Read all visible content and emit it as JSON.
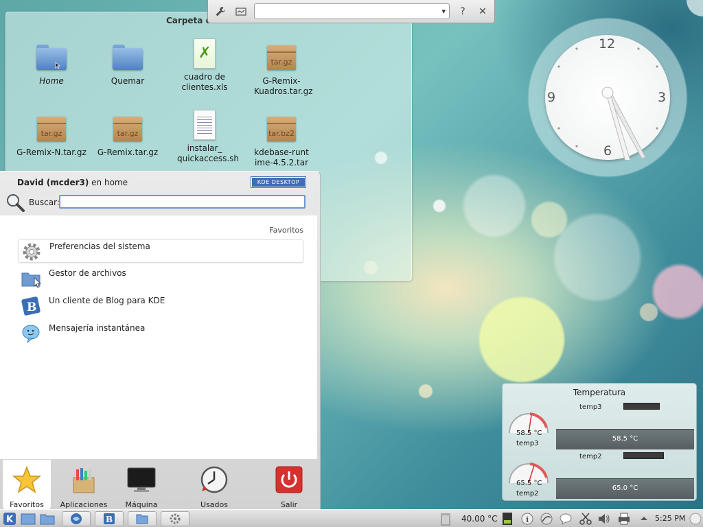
{
  "folder_view": {
    "title": "Carpeta de",
    "files": [
      {
        "name": "Home",
        "kind": "folder",
        "label_style": "italic"
      },
      {
        "name": "Quemar",
        "kind": "folder"
      },
      {
        "name": "cuadro de clientes.xls",
        "kind": "spreadsheet"
      },
      {
        "name": "G-Remix-Kuadros.tar.gz",
        "kind": "archive",
        "badge": "tar.gz"
      },
      {
        "name": "G-Remix-N.tar.gz",
        "kind": "archive",
        "badge": "tar.gz"
      },
      {
        "name": "G-Remix.tar.gz",
        "kind": "archive",
        "badge": "tar.gz"
      },
      {
        "name": "instalar_ quickaccess.sh",
        "kind": "script"
      },
      {
        "name": "kdebase-runtime-4.5.2.tar",
        "kind": "archive",
        "badge": "tar.bz2"
      }
    ]
  },
  "toolbar": {
    "icons": [
      "wrench-icon",
      "configure-icon",
      "help-icon",
      "close-icon"
    ],
    "help_glyph": "?",
    "close_glyph": "✕",
    "combo_value": ""
  },
  "clock": {
    "numerals": [
      "12",
      "3",
      "6",
      "9"
    ],
    "time": "5:25 PM"
  },
  "launcher": {
    "user_name": "David (mcder3)",
    "user_suffix": " en home",
    "badge": "KDE DESKTOP",
    "search_label": "Buscar:",
    "search_value": "",
    "section_title": "Favoritos",
    "favorites": [
      {
        "label": "Preferencias del sistema",
        "icon": "gear-icon"
      },
      {
        "label": "Gestor de archivos",
        "icon": "folder-icon"
      },
      {
        "label": "Un cliente de Blog para KDE",
        "icon": "blog-icon"
      },
      {
        "label": "Mensajería instantánea",
        "icon": "chat-icon"
      }
    ],
    "tabs": [
      {
        "label": "Favoritos",
        "icon": "star-icon",
        "active": true
      },
      {
        "label": "Aplicaciones",
        "icon": "applications-icon"
      },
      {
        "label": "Máquina",
        "icon": "computer-icon"
      },
      {
        "label": "Usados recientemente",
        "icon": "recent-clock-icon"
      },
      {
        "label": "Salir",
        "icon": "power-icon"
      }
    ]
  },
  "temperature": {
    "title": "Temperatura",
    "sensors": [
      {
        "name": "temp3",
        "value": "58.5 °C",
        "graph_value": "58.5 °C",
        "level": 0.585
      },
      {
        "name": "temp2",
        "value": "65.5 °C",
        "graph_value": "65.0 °C",
        "level": 0.655
      }
    ]
  },
  "panel": {
    "temperature": "40.00 °C",
    "time": "5:25 PM",
    "colors": {
      "panel_bg": "#d4d4d4",
      "accent": "#3d6fb4"
    }
  }
}
